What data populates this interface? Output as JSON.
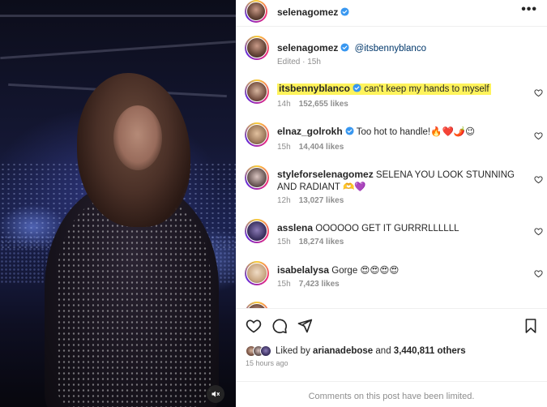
{
  "post": {
    "username": "selenagomez",
    "more_icon": "more-horizontal-icon"
  },
  "caption": {
    "username": "selenagomez",
    "mention": "@itsbennyblanco",
    "edited": "Edited",
    "time": "15h"
  },
  "comments": [
    {
      "username": "itsbennyblanco",
      "verified": true,
      "text": "can't keep my hands to myself",
      "time": "14h",
      "likes": "152,655 likes",
      "highlighted": true
    },
    {
      "username": "elnaz_golrokh",
      "verified": true,
      "text": "Too hot to handle!🔥❤️🌶️😉",
      "time": "15h",
      "likes": "14,404 likes"
    },
    {
      "username": "styleforselenagomez",
      "verified": false,
      "text": "SELENA YOU LOOK STUNNING AND RADIANT 🫶💜",
      "time": "12h",
      "likes": "13,027 likes"
    },
    {
      "username": "asslena",
      "verified": false,
      "text": "OOOOOO GET IT GURRRLLLLLL",
      "time": "15h",
      "likes": "18,274 likes"
    },
    {
      "username": "isabelalysa",
      "verified": false,
      "text": "Gorge 😍😍😍😍",
      "time": "15h",
      "likes": "7,423 likes"
    }
  ],
  "likes": {
    "prefix": "Liked by",
    "user": "arianadebose",
    "and": "and",
    "count": "3,440,811 others"
  },
  "time_ago": "15 hours ago",
  "comments_limited": "Comments on this post have been limited.",
  "colors": {
    "verified": "#3897f0",
    "highlight": "#fff35b",
    "muted_text": "#8e8e8e"
  }
}
